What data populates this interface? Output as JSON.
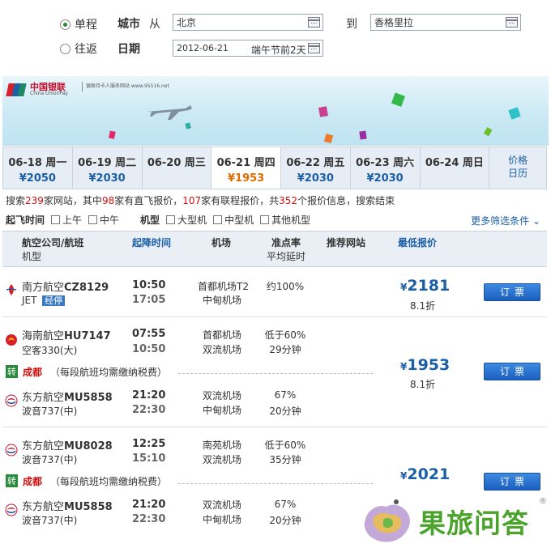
{
  "search": {
    "one_way": "单程",
    "round_trip": "往返",
    "city_label": "城市",
    "from_word": "从",
    "from_city": "北京",
    "to_word": "到",
    "to_city": "香格里拉",
    "date_label": "日期",
    "date_value": "2012-06-21",
    "date_note": "端午节前2天"
  },
  "banner": {
    "bank_name": "中国银联",
    "bank_en": "China UnionPay",
    "slogan": "银联持卡人服务网站 www.95516.net"
  },
  "date_tabs": [
    {
      "date": "06-18 周一",
      "price": "¥2050"
    },
    {
      "date": "06-19 周二",
      "price": "¥2030"
    },
    {
      "date": "06-20 周三",
      "price": ""
    },
    {
      "date": "06-21 周四",
      "price": "¥1953"
    },
    {
      "date": "06-22 周五",
      "price": "¥2030"
    },
    {
      "date": "06-23 周六",
      "price": "¥2030"
    },
    {
      "date": "06-24 周日",
      "price": ""
    }
  ],
  "price_calendar": {
    "line1": "价格",
    "line2": "日历"
  },
  "summary": {
    "t1": "搜索",
    "sites": "239",
    "t2": "家网站，其中",
    "direct": "98",
    "t3": "家有直飞报价，",
    "connect": "107",
    "t4": "家有联程报价，共",
    "quotes": "352",
    "t5": "个报价信息，搜索结束"
  },
  "filters": {
    "time_title": "起飞时间",
    "am": "上午",
    "noon": "中午",
    "type_title": "机型",
    "large": "大型机",
    "medium": "中型机",
    "other": "其他机型",
    "more": "更多筛选条件"
  },
  "headers": {
    "airline": "航空公司/航班",
    "model": "机型",
    "times": "起降时间",
    "airport": "机场",
    "punctual": "准点率",
    "avg_delay": "平均延时",
    "sites": "推荐网站",
    "lowest": "最低报价"
  },
  "flights": {
    "f1": {
      "airline": "南方航空",
      "flight": "CZ8129",
      "model": "JET",
      "stop": "经停",
      "dep": "10:50",
      "arr": "17:05",
      "apt_dep": "首都机场T2",
      "apt_arr": "中甸机场",
      "punctual": "约100%",
      "delay": "",
      "price": "2181",
      "disc": "8.1折",
      "book": "订票"
    },
    "f2": {
      "airline": "海南航空",
      "flight": "HU7147",
      "model": "空客330(大)",
      "dep": "07:55",
      "arr": "10:50",
      "apt_dep": "首都机场",
      "apt_arr": "双流机场",
      "punctual": "低于60%",
      "delay": "29分钟"
    },
    "t1": {
      "badge": "转",
      "city": "成都",
      "note": "（每段航班均需缴纳税费）"
    },
    "f3": {
      "airline": "东方航空",
      "flight": "MU5858",
      "model": "波音737(中)",
      "dep": "21:20",
      "arr": "22:30",
      "apt_dep": "双流机场",
      "apt_arr": "中甸机场",
      "punctual": "67%",
      "delay": "20分钟"
    },
    "combo1": {
      "price": "1953",
      "disc": "8.1折",
      "book": "订票"
    },
    "f4": {
      "airline": "东方航空",
      "flight": "MU8028",
      "model": "波音737(中)",
      "dep": "12:25",
      "arr": "15:10",
      "apt_dep": "南苑机场",
      "apt_arr": "双流机场",
      "punctual": "低于60%",
      "delay": "35分钟"
    },
    "t2": {
      "badge": "转",
      "city": "成都",
      "note": "（每段航班均需缴纳税费）"
    },
    "f5": {
      "airline": "东方航空",
      "flight": "MU5858",
      "model": "波音737(中)",
      "dep": "21:20",
      "arr": "22:30",
      "apt_dep": "双流机场",
      "apt_arr": "中甸机场",
      "punctual": "67%",
      "delay": "20分钟"
    },
    "combo2": {
      "price": "2021",
      "book": "订票"
    }
  },
  "watermark": {
    "text": "果旅问答",
    "reg": "®"
  },
  "colors": {
    "accent": "#1b5fa5",
    "price_active": "#e06a00",
    "red": "#d01010",
    "button": "#1a5fbf"
  }
}
